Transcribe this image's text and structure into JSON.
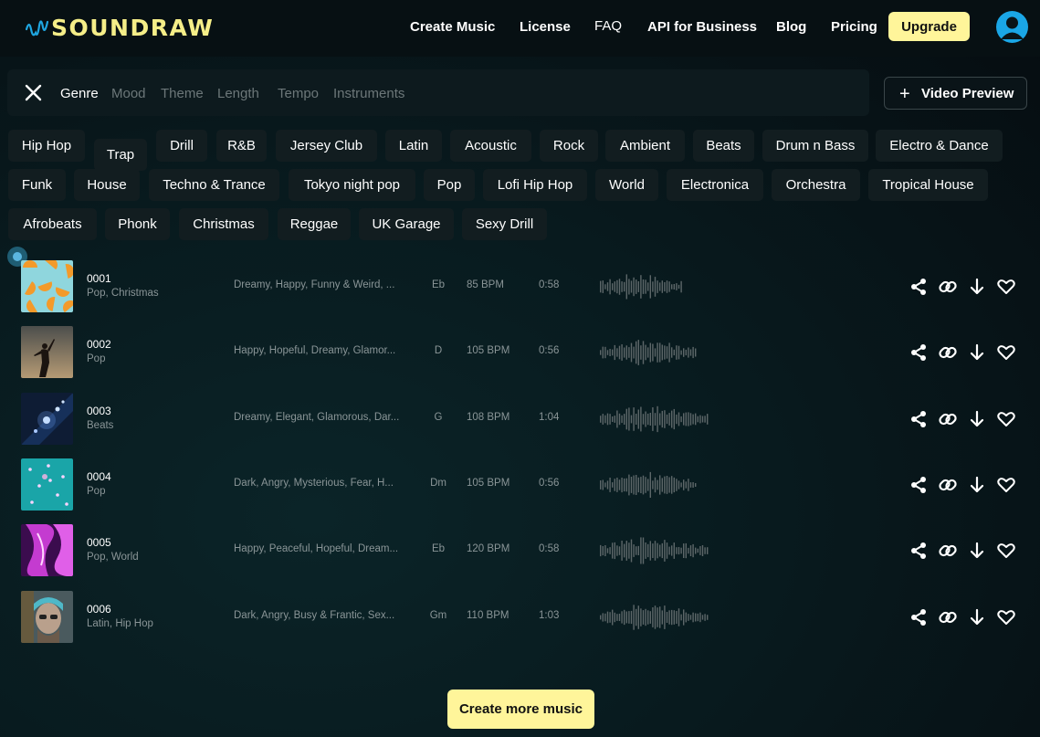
{
  "brand": {
    "name": "SOUNDRAW",
    "accent": "#fff59a"
  },
  "nav": {
    "create_music": "Create Music",
    "license": "License",
    "faq": "FAQ",
    "api": "API for Business",
    "blog": "Blog",
    "pricing": "Pricing",
    "upgrade": "Upgrade"
  },
  "filters": {
    "tabs": [
      "Genre",
      "Mood",
      "Theme",
      "Length",
      "Tempo",
      "Instruments"
    ],
    "active_tab": "Genre",
    "video_preview": "Video Preview"
  },
  "genres": [
    "Hip Hop",
    "Trap",
    "Drill",
    "R&B",
    "Jersey Club",
    "Latin",
    "Acoustic",
    "Rock",
    "Ambient",
    "Beats",
    "Drum n Bass",
    "Electro & Dance",
    "Funk",
    "House",
    "Techno & Trance",
    "Tokyo night pop",
    "Pop",
    "Lofi Hip Hop",
    "World",
    "Electronica",
    "Orchestra",
    "Tropical House",
    "Afrobeats",
    "Phonk",
    "Christmas",
    "Reggae",
    "UK Garage",
    "Sexy Drill"
  ],
  "tracks": [
    {
      "num": "0001",
      "genre": "Pop, Christmas",
      "mood": "Dreamy, Happy, Funny & Weird, ...",
      "key": "Eb",
      "bpm": "85 BPM",
      "length": "0:58",
      "art": "oranges"
    },
    {
      "num": "0002",
      "genre": "Pop",
      "mood": "Happy, Hopeful, Dreamy, Glamor...",
      "key": "D",
      "bpm": "105 BPM",
      "length": "0:56",
      "art": "silhouette"
    },
    {
      "num": "0003",
      "genre": "Beats",
      "mood": "Dreamy, Elegant, Glamorous, Dar...",
      "key": "G",
      "bpm": "108 BPM",
      "length": "1:04",
      "art": "lights"
    },
    {
      "num": "0004",
      "genre": "Pop",
      "mood": "Dark, Angry, Mysterious, Fear, H...",
      "key": "Dm",
      "bpm": "105 BPM",
      "length": "0:56",
      "art": "teal"
    },
    {
      "num": "0005",
      "genre": "Pop, World",
      "mood": "Happy, Peaceful, Hopeful, Dream...",
      "key": "Eb",
      "bpm": "120 BPM",
      "length": "0:58",
      "art": "purple"
    },
    {
      "num": "0006",
      "genre": "Latin, Hip Hop",
      "mood": "Dark, Angry, Busy & Frantic, Sex...",
      "key": "Gm",
      "bpm": "110 BPM",
      "length": "1:03",
      "art": "portrait"
    }
  ],
  "track_actions": [
    "share-icon",
    "link-icon",
    "download-icon",
    "heart-icon"
  ],
  "create_more": "Create more music"
}
